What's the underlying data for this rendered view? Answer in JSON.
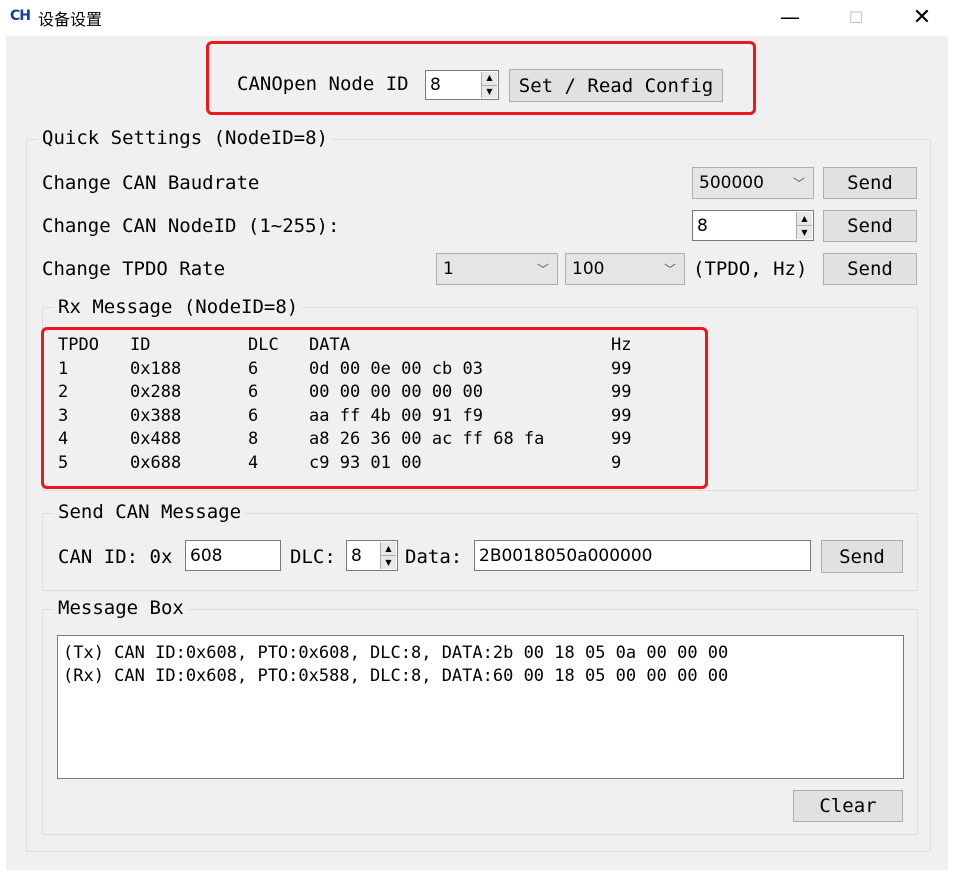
{
  "window": {
    "icon_text": "CH",
    "title": "设备设置",
    "minimize": "—",
    "maximize": "☐",
    "close": "✕"
  },
  "node": {
    "label": "CANOpen Node ID",
    "value": "8",
    "set_read_button": "Set / Read Config"
  },
  "quick": {
    "title": "Quick Settings (NodeID=8)",
    "baud_label": "Change CAN Baudrate",
    "baud_value": "500000",
    "nodeid_label": "Change CAN NodeID (1~255):",
    "nodeid_value": "8",
    "tpdo_label": "Change TPDO Rate",
    "tpdo_value": "1",
    "rate_value": "100",
    "tpdo_unit": "(TPDO, Hz)",
    "send": "Send"
  },
  "rx": {
    "title": "Rx Message (NodeID=8)",
    "headers": [
      "TPDO",
      "ID",
      "DLC",
      "DATA",
      "Hz"
    ],
    "rows": [
      [
        "1",
        "0x188",
        "6",
        "0d 00 0e 00 cb 03",
        "99"
      ],
      [
        "2",
        "0x288",
        "6",
        "00 00 00 00 00 00",
        "99"
      ],
      [
        "3",
        "0x388",
        "6",
        "aa ff 4b 00 91 f9",
        "99"
      ],
      [
        "4",
        "0x488",
        "8",
        "a8 26 36 00 ac ff 68 fa",
        "99"
      ],
      [
        "5",
        "0x688",
        "4",
        "c9 93 01 00",
        "9"
      ]
    ]
  },
  "send_msg": {
    "title": "Send CAN Message",
    "id_label": "CAN ID: 0x",
    "id_value": "608",
    "dlc_label": "DLC:",
    "dlc_value": "8",
    "data_label": "Data:",
    "data_value": "2B0018050a000000",
    "send": "Send"
  },
  "message_box": {
    "title": "Message Box",
    "lines": [
      "(Tx) CAN ID:0x608, PTO:0x608, DLC:8, DATA:2b 00 18 05 0a 00 00 00",
      "(Rx) CAN ID:0x608, PTO:0x588, DLC:8, DATA:60 00 18 05 00 00 00 00"
    ],
    "clear": "Clear"
  },
  "colors": {
    "highlight": "#e8191f",
    "background": "#f0f0f0"
  }
}
